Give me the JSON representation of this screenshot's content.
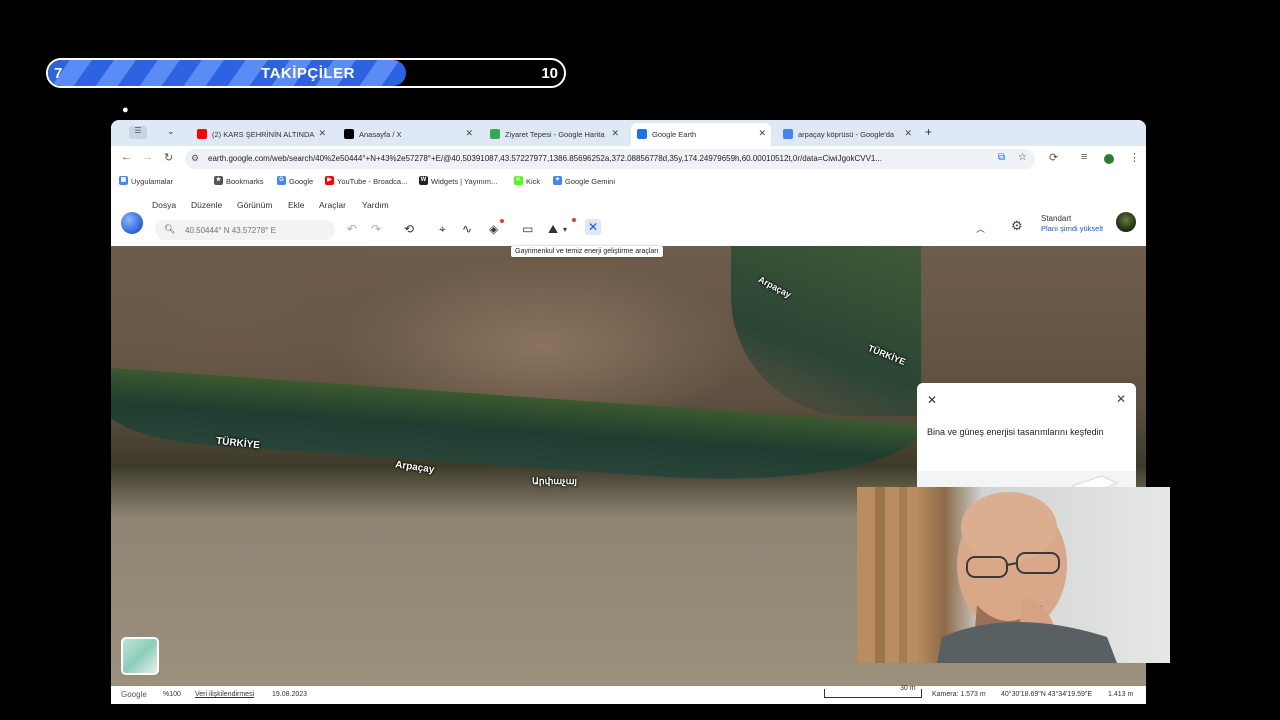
{
  "follower_bar": {
    "current": "7",
    "title": "TAKİPÇİLER",
    "target": "10",
    "progress": 0.7
  },
  "browser": {
    "tabs": [
      {
        "label": "(2) KARS ŞEHRİNİN ALTINDA",
        "icon": "youtube-icon",
        "icon_color": "#ff0000",
        "active": false
      },
      {
        "label": "Anasayfa / X",
        "icon": "x-icon",
        "icon_color": "#000000",
        "active": false
      },
      {
        "label": "Ziyaret Tepesi - Google Harita",
        "icon": "maps-icon",
        "icon_color": "#34a853",
        "active": false
      },
      {
        "label": "Google Earth",
        "icon": "earth-icon",
        "icon_color": "#1a73e8",
        "active": true
      },
      {
        "label": "arpaçay köprüsü - Google'da",
        "icon": "google-icon",
        "icon_color": "#4285f4",
        "active": false
      }
    ],
    "url": "earth.google.com/web/search/40%2e50444°+N+43%2e57278°+E/@40.50391087,43.57227977,1386.85696252a,372.08856778d,35y,174.24979659h,60.00010512t,0r/data=CiwiJgokCVV1...",
    "bookmarks": [
      {
        "label": "Uygulamalar",
        "icon": "apps-grid-icon",
        "color": "#4285f4"
      },
      {
        "label": "Bookmarks",
        "icon": "star-icon",
        "color": "#555555"
      },
      {
        "label": "Google",
        "icon": "google-icon",
        "color": "#4285f4"
      },
      {
        "label": "YouTube - Broadca...",
        "icon": "youtube-icon",
        "color": "#ff0000"
      },
      {
        "label": "Widgets | Yayınım...",
        "icon": "widgets-icon",
        "color": "#222222"
      },
      {
        "label": "Kick",
        "icon": "kick-icon",
        "color": "#53fc18"
      },
      {
        "label": "Google Gemini",
        "icon": "gemini-icon",
        "color": "#4285f4"
      }
    ]
  },
  "earth": {
    "menu": [
      "Dosya",
      "Düzenle",
      "Görünüm",
      "Ekle",
      "Araçlar",
      "Yardım"
    ],
    "search_placeholder": "40.50444° N 43.57278° E",
    "tooltip": "Gayrimenkul ve temiz enerji geliştirme araçları",
    "plan_name": "Standart",
    "plan_upgrade": "Planı şimdi yükselt",
    "accent": "#1a56db"
  },
  "map": {
    "labels": [
      "Arpaçay",
      "TÜRKİYE",
      "TÜRKİYE",
      "Arpaçay",
      "Արփաչայ"
    ]
  },
  "panel": {
    "text": "Bina ve güneş enerjisi tasarımlarını keşfedin"
  },
  "statusbar": {
    "google": "Google",
    "zoom": "%100",
    "data_link": "Veri ilişkilendirmesi",
    "date": "19.08.2023",
    "scale": "30 m",
    "camera": "Kamera: 1.573 m",
    "coords": "40°30'18.69\"N 43°34'19.59\"E",
    "elevation": "1.413 m"
  }
}
